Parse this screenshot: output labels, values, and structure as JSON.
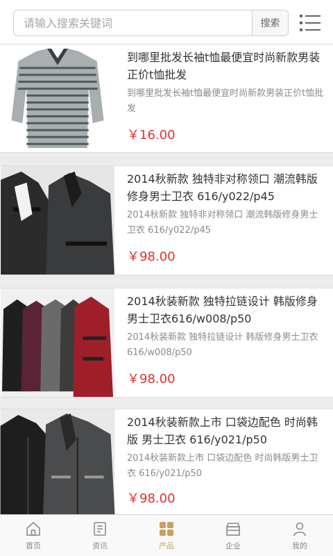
{
  "search": {
    "placeholder": "请输入搜索关键词",
    "value": "",
    "button_label": "搜索"
  },
  "products": [
    {
      "title": "到哪里批发长袖t恤最便宜时尚新款男装正价t恤批发",
      "description": "到哪里批发长袖t恤最便宜时尚新款男装正价t恤批发",
      "price": "￥16.00"
    },
    {
      "title": "2014秋新款 独特非对称领口 潮流韩版 修身男士卫衣 616/y022/p45",
      "description": "2014秋新款 独特非对称领口 潮流韩版修身男士卫衣 616/y022/p45",
      "price": "￥98.00"
    },
    {
      "title": "2014秋装新款 独特拉链设计 韩版修身 男士卫衣616/w008/p50",
      "description": "2014秋装新款 独特拉链设计 韩版修身男士卫衣616/w008/p50",
      "price": "￥98.00"
    },
    {
      "title": "2014秋装新款上市 口袋边配色 时尚韩版 男士卫衣 616/y021/p50",
      "description": "2014秋装新款上市 口袋边配色 时尚韩版男士卫衣 616/y021/p50",
      "price": "￥98.00"
    }
  ],
  "tabbar": {
    "items": [
      {
        "label": "首页",
        "icon": "home-icon"
      },
      {
        "label": "资讯",
        "icon": "news-icon"
      },
      {
        "label": "产品",
        "icon": "grid-icon"
      },
      {
        "label": "企业",
        "icon": "building-icon"
      },
      {
        "label": "我的",
        "icon": "user-icon"
      }
    ],
    "active_index": 2
  },
  "colors": {
    "price": "#e62e2e",
    "active_tab": "#c9a05e",
    "background": "#ececec"
  }
}
